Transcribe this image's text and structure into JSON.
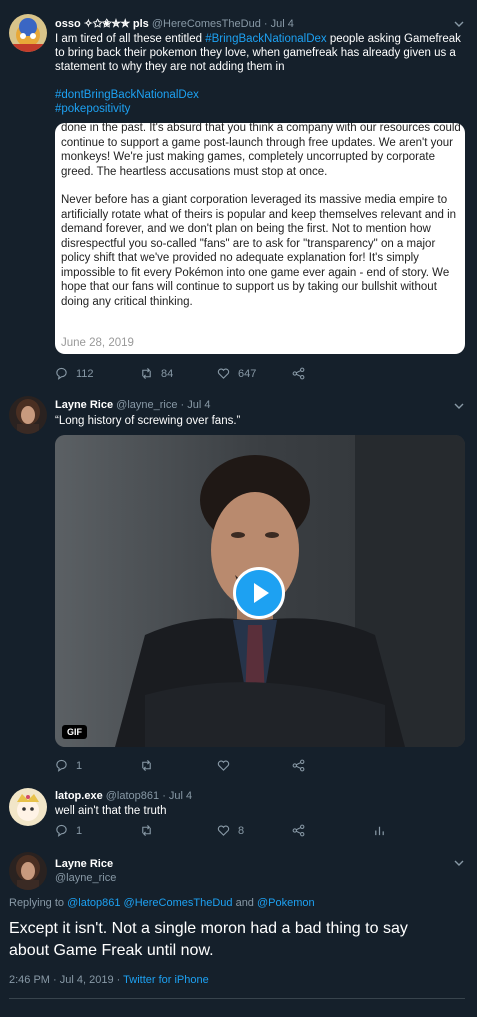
{
  "tweet1": {
    "display_name": "osso ✧✩✬✮✯ pls",
    "handle": "@HereComesTheDud",
    "date": "Jul 4",
    "text_before": "I am tired of all these entitled ",
    "hashtag1": "#BringBackNationalDex",
    "text_after": " people asking Gamefreak to bring back their pokemon they love, when gamefreak has already given us a statement to why they are not adding them in",
    "hashtag2": "#dontBringBackNationalDex",
    "hashtag3": "#pokepositivity",
    "card": {
      "para1": "done in the past. It's absurd that you think a company with our resources could continue to support a game post-launch through free updates. We aren't your monkeys! We're just making games, completely uncorrupted by corporate greed. The heartless accusations must stop at once.",
      "para2": "Never before has a giant corporation leveraged its massive media empire to artificially rotate what of theirs is popular and keep themselves relevant and in demand forever, and we don't plan on being the first. Not to mention how disrespectful you so-called \"fans\" are to ask for \"transparency\" on a major policy shift that we've provided no adequate explanation for! It's simply impossible to fit every Pokémon into one game ever again - end of story. We hope that our fans will continue to support us by taking our bullshit without doing any critical thinking.",
      "date": "June 28, 2019"
    },
    "replies": "112",
    "retweets": "84",
    "likes": "647"
  },
  "tweet2": {
    "display_name": "Layne Rice",
    "handle": "@layne_rice",
    "date": "Jul 4",
    "text": "“Long history of screwing over fans.”",
    "gif_badge": "GIF",
    "replies": "1",
    "retweets": "",
    "likes": ""
  },
  "tweet3": {
    "display_name": "latop.exe",
    "handle": "@latop861",
    "date": "Jul 4",
    "text": "well ain't that the truth",
    "replies": "1",
    "retweets": "",
    "likes": "8"
  },
  "main": {
    "display_name": "Layne Rice",
    "handle": "@layne_rice",
    "replying_prefix": "Replying to ",
    "replying_users": "@latop861 @HereComesTheDud",
    "replying_and": " and ",
    "replying_last": "@Pokemon",
    "text": "Except it isn't. Not a single moron had a bad thing to say about Game Freak until now.",
    "time": "2:46 PM · Jul 4, 2019 · ",
    "client": "Twitter for iPhone"
  },
  "colors": {
    "background": "#15202b",
    "accent": "#1da1f2",
    "muted": "#8899a6",
    "divider": "#38444d"
  }
}
